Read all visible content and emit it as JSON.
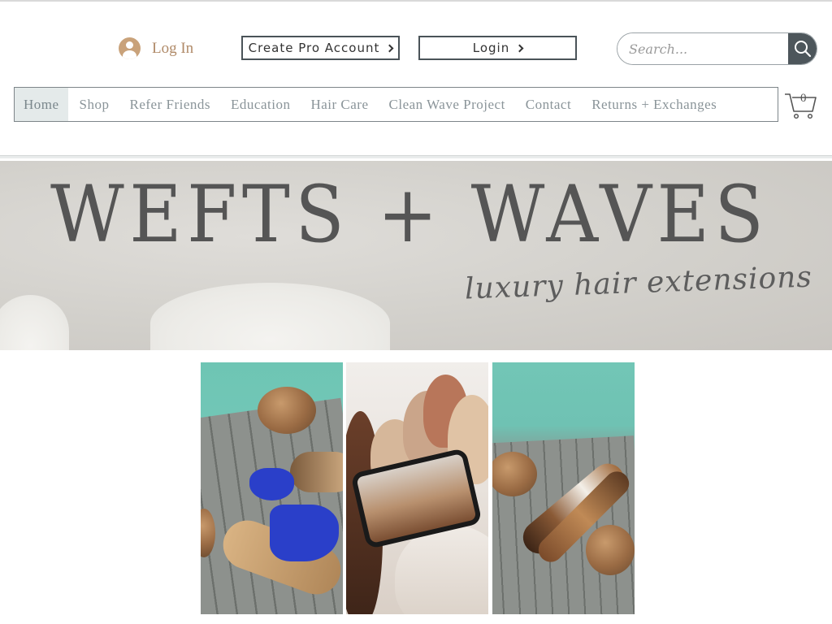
{
  "header": {
    "login_link": "Log In",
    "create_pro_account": "Create Pro Account",
    "login_button": "Login",
    "search_placeholder": "Search..."
  },
  "nav": {
    "items": [
      {
        "label": "Home",
        "active": true
      },
      {
        "label": "Shop"
      },
      {
        "label": "Refer Friends"
      },
      {
        "label": "Education"
      },
      {
        "label": "Hair Care"
      },
      {
        "label": "Clean Wave Project"
      },
      {
        "label": "Contact"
      },
      {
        "label": "Returns + Exchanges"
      }
    ],
    "cart_count": "0"
  },
  "banner": {
    "title": "WEFTS + WAVES",
    "subtitle": "luxury hair extensions"
  },
  "colors": {
    "accent_brown": "#b08a68",
    "button_border": "#4a5358",
    "search_button": "#4d565b",
    "nav_text": "#8a9499",
    "active_nav_bg": "#e4eaea"
  }
}
